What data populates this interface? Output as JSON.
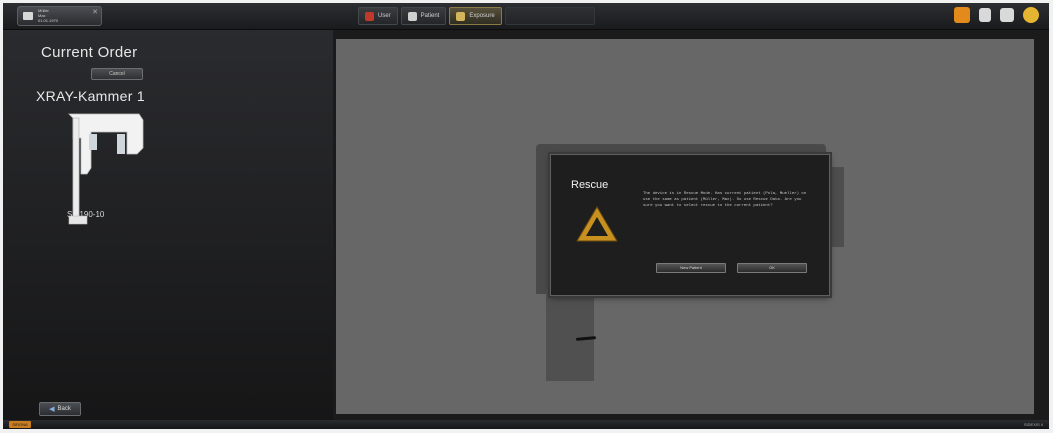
{
  "topbar": {
    "patient": {
      "lines": [
        "Müller",
        "Max",
        "01.01.1970"
      ]
    },
    "tabs": [
      {
        "label": "User",
        "icon": "user-icon",
        "color": "#c0392b"
      },
      {
        "label": "Patient",
        "icon": "patient-icon",
        "color": "#cfcfcf"
      },
      {
        "label": "Exposure",
        "icon": "exposure-icon",
        "color": "#d4b45a"
      }
    ]
  },
  "left": {
    "title": "Current Order",
    "order_button": "Cancel",
    "device_name": "XRAY-Kammer 1",
    "device_model": "SL-190-10",
    "back_label": "Back"
  },
  "dialog": {
    "title": "Rescue",
    "message": "The device is in Rescue Mode. Has current patient (Pola, Mueller) on use the same as patient (Müller, Max). So use Rescue Data. Are you sure you want to select rescue to the current patient?",
    "buttons": [
      "New Patient",
      "OK"
    ],
    "icon": "warning-triangle-icon",
    "accent": "#c8901e"
  },
  "status": {
    "left": "SIRONA",
    "right": "SIDEXIS 4"
  },
  "colors": {
    "main_bg": "#676767",
    "panel_bg": "#1b1b1c",
    "accent": "#e8a020"
  }
}
